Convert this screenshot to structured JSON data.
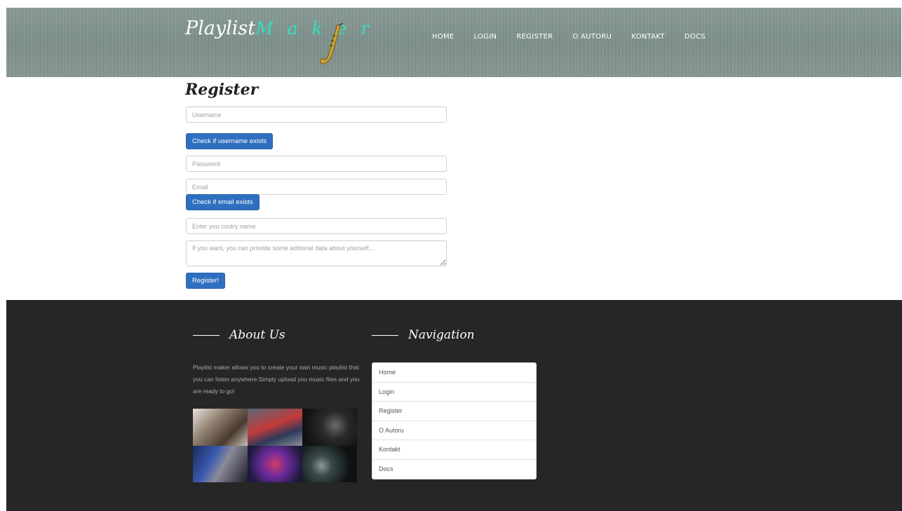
{
  "header": {
    "logo_part1": "Playlist",
    "logo_part2": "M a k e r",
    "nav": [
      "HOME",
      "LOGIN",
      "REGISTER",
      "O AUTORU",
      "KONTAKT",
      "DOCS"
    ]
  },
  "form": {
    "title": "Register",
    "username_placeholder": "Username",
    "check_username_label": "Check if username exists",
    "password_placeholder": "Password",
    "email_placeholder": "Email",
    "check_email_label": "Check if email exists",
    "country_placeholder": "Enter you coutry name",
    "about_placeholder": "If you want, you can provide some aditional data about yourself...",
    "register_label": "Register!"
  },
  "footer": {
    "about_heading": "About Us",
    "about_text": "Playlist maker allows you to create your own music playlist that you can listen anywhere.Simply upload you music files and you are ready to go!",
    "navigation_heading": "Navigation",
    "nav_items": [
      "Home",
      "Login",
      "Register",
      "O Autoru",
      "Kontakt",
      "Docs"
    ]
  },
  "colors": {
    "header_bg": "#869793",
    "accent_teal": "#33e0c0",
    "button_blue": "#2f6fbf",
    "footer_bg": "#262626"
  }
}
